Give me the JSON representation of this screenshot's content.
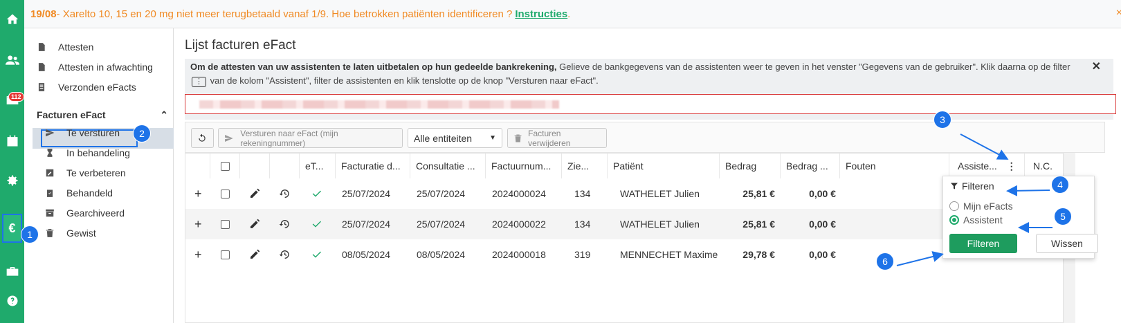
{
  "banner": {
    "date": "19/08",
    "message": " - Xarelto 10, 15 en 20 mg niet meer terugbetaald vanaf 1/9. Hoe betrokken patiënten identificeren ?",
    "link": "Instructies",
    "suffix": ".",
    "close": "×"
  },
  "rail": {
    "mail_badge": "112",
    "euro": "€"
  },
  "sidebar": {
    "items": [
      {
        "label": "Attesten"
      },
      {
        "label": "Attesten in afwachting"
      },
      {
        "label": "Verzonden eFacts"
      }
    ],
    "section": "Facturen eFact",
    "sub": [
      {
        "label": "Te versturen"
      },
      {
        "label": "In behandeling"
      },
      {
        "label": "Te verbeteren"
      },
      {
        "label": "Behandeld"
      },
      {
        "label": "Gearchiveerd"
      },
      {
        "label": "Gewist"
      }
    ]
  },
  "main": {
    "title": "Lijst facturen eFact",
    "info_bold": "Om de attesten van uw assistenten te laten uitbetalen op hun gedeelde bankrekening,",
    "info_text1": " Gelieve de bankgegevens van de assistenten weer te geven in het venster \"Gegevens van de gebruiker\". Klik daarna op de filter ",
    "info_kbd": "⋮",
    "info_text2": " van de kolom \"Assistent\", filter de assistenten en klik tenslotte op de knop \"Versturen naar eFact\".",
    "info_close": "✕"
  },
  "toolbar": {
    "send": "Versturen naar eFact (mijn rekeningnummer)",
    "entity": "Alle entiteiten",
    "delete": "Facturen verwijderen"
  },
  "table": {
    "headers": {
      "efact": "eT...",
      "invoice_date": "Facturatie d...",
      "consult": "Consultatie ...",
      "invoice_nr": "Factuurnum...",
      "mutual": "Zie...",
      "patient": "Patiënt",
      "amount": "Bedrag",
      "amount2": "Bedrag ...",
      "errors": "Fouten",
      "assistant": "Assiste...",
      "nc": "N.C."
    },
    "rows": [
      {
        "plus": "+",
        "invoice_date": "25/07/2024",
        "consult": "25/07/2024",
        "invoice_nr": "2024000024",
        "mutual": "134",
        "patient": "WATHELET Julien",
        "amount": "25,81 €",
        "amount2": "0,00 €"
      },
      {
        "plus": "+",
        "invoice_date": "25/07/2024",
        "consult": "25/07/2024",
        "invoice_nr": "2024000022",
        "mutual": "134",
        "patient": "WATHELET Julien",
        "amount": "25,81 €",
        "amount2": "0,00 €"
      },
      {
        "plus": "+",
        "invoice_date": "08/05/2024",
        "consult": "08/05/2024",
        "invoice_nr": "2024000018",
        "mutual": "319",
        "patient": "MENNECHET Maxime",
        "amount": "29,78 €",
        "amount2": "0,00 €"
      }
    ]
  },
  "filter": {
    "title": "Filteren",
    "opt1": "Mijn eFacts",
    "opt2": "Assistent",
    "apply": "Filteren",
    "clear": "Wissen"
  },
  "annotations": [
    "1",
    "2",
    "3",
    "4",
    "5",
    "6"
  ]
}
